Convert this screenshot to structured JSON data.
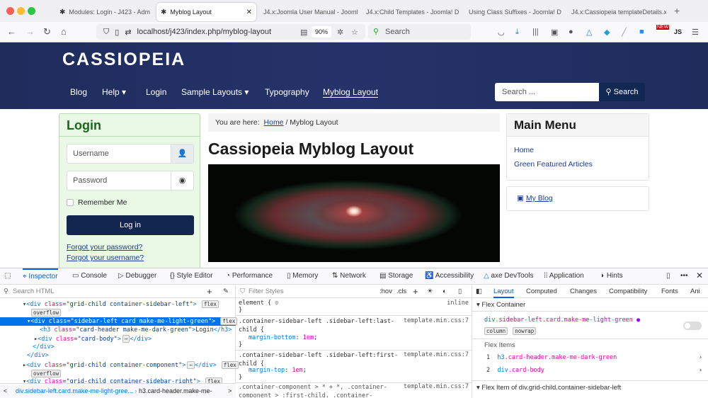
{
  "browser": {
    "tabs": [
      {
        "label": "Modules: Login - J423 - Adm",
        "active": false
      },
      {
        "label": "Myblog Layout",
        "active": true
      },
      {
        "label": "J4.x:Joomla User Manual - Jooml",
        "active": false
      },
      {
        "label": "J4.x:Child Templates - Joomla! D",
        "active": false
      },
      {
        "label": "Using Class Suffixes - Joomla! D",
        "active": false
      },
      {
        "label": "J4.x:Cassiopeia templateDetails.x",
        "active": false
      }
    ],
    "url": "localhost/j423/index.php/myblog-layout",
    "zoom": "90%",
    "search_placeholder": "Search",
    "ext_badge": "NEW",
    "ext_js": "JS"
  },
  "site": {
    "logo": "CASSIOPEIA",
    "menu": [
      "Blog",
      "Help",
      "Login",
      "Sample Layouts",
      "Typography",
      "Myblog Layout"
    ],
    "search_placeholder": "Search ...",
    "search_button": "Search",
    "login": {
      "title": "Login",
      "username": "Username",
      "password": "Password",
      "remember": "Remember Me",
      "button": "Log in",
      "forgot_password": "Forgot your password?",
      "forgot_username": "Forgot your username?"
    },
    "breadcrumb": {
      "prefix": "You are here:",
      "home": "Home",
      "sep": "/",
      "current": "Myblog Layout"
    },
    "title": "Cassiopeia Myblog Layout",
    "main_menu": {
      "title": "Main Menu",
      "items": [
        "Home",
        "Green Featured Articles"
      ]
    },
    "feed_link": "My Blog"
  },
  "devtools": {
    "tabs": [
      "Inspector",
      "Console",
      "Debugger",
      "Style Editor",
      "Performance",
      "Memory",
      "Network",
      "Storage",
      "Accessibility",
      "axe DevTools",
      "Application",
      "Hints"
    ],
    "search_html": "Search HTML",
    "filter_styles": "Filter Styles",
    "hov": ":hov",
    "cls": ".cls",
    "html": {
      "l1": {
        "tag": "div",
        "attr": "class",
        "val": "grid-child container-sidebar-left",
        "badges": [
          "flex",
          "overflow"
        ]
      },
      "l2": {
        "tag": "div",
        "attr": "class",
        "val": "sidebar-left card make-me-light-green",
        "badge": "flex"
      },
      "l3": {
        "tag": "h3",
        "attr": "class",
        "val": "card-header make-me-dark-green",
        "text": "Login"
      },
      "l4": {
        "tag": "div",
        "attr": "class",
        "val": "card-body"
      },
      "l5": "</div>",
      "l6": "</div>",
      "l7": {
        "tag": "div",
        "attr": "class",
        "val": "grid-child container-component",
        "badges": [
          "flex",
          "overflow"
        ]
      },
      "l8": {
        "tag": "div",
        "attr": "class",
        "val": "grid-child container-sidebar-right",
        "badge": "flex"
      }
    },
    "breadcrumbs": [
      "div.sidebar-left.card.make-me-light-gree...",
      "h3.card-header.make-me-"
    ],
    "rules": [
      {
        "selector": "element {",
        "source": "inline",
        "decls": []
      },
      {
        "selector": ".container-sidebar-left .sidebar-left:last-child {",
        "source": "template.min.css:7",
        "decls": [
          {
            "p": "margin-bottom",
            "v": "1em"
          }
        ]
      },
      {
        "selector": ".container-sidebar-left .sidebar-left:first-child {",
        "source": "template.min.css:7",
        "decls": [
          {
            "p": "margin-top",
            "v": "1em"
          }
        ]
      },
      {
        "selector": ".container-component > * + *, .container-component > :first-child, .container-sidebar-",
        "source": "template.min.css:7",
        "decls": []
      }
    ],
    "layout": {
      "tabs": [
        "Layout",
        "Computed",
        "Changes",
        "Compatibility",
        "Fonts",
        "Ani"
      ],
      "flex_container": "Flex Container",
      "container_tag": "div",
      "container_class": ".sidebar-left.card.make-me-light-green",
      "badges": [
        "column",
        "nowrap"
      ],
      "flex_items": "Flex Items",
      "items": [
        {
          "n": "1",
          "tag": "h3",
          "cls": ".card-header.make-me-dark-green"
        },
        {
          "n": "2",
          "tag": "div",
          "cls": ".card-body"
        }
      ],
      "flex_item_of": "Flex Item of div.grid-child.container-sidebar-left"
    }
  }
}
